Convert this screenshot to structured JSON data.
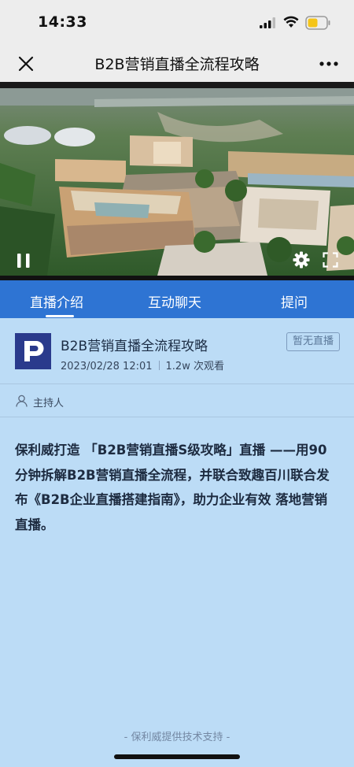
{
  "status_bar": {
    "time": "14:33",
    "icons": [
      "signal-icon",
      "wifi-icon",
      "battery-icon"
    ],
    "battery_color": "#f5c518"
  },
  "nav": {
    "title": "B2B营销直播全流程攻略",
    "icons": [
      "close-icon",
      "more-icon"
    ]
  },
  "video": {
    "controls": [
      "pause-icon",
      "gear-icon",
      "fullscreen-icon"
    ]
  },
  "tabs": {
    "items": [
      {
        "label": "直播介绍",
        "active": true
      },
      {
        "label": "互动聊天",
        "active": false
      },
      {
        "label": "提问",
        "active": false
      }
    ],
    "color": "#2e74d3"
  },
  "live": {
    "logo_icon": "channel-logo-icon",
    "title": "B2B营销直播全流程攻略",
    "datetime": "2023/02/28 12:01",
    "views": "1.2w 次观看",
    "status_badge": "暂无直播"
  },
  "host": {
    "icon": "user-icon",
    "label": "主持人"
  },
  "description": "保利威打造 「B2B营销直播S级攻略」直播 ——用90分钟拆解B2B营销直播全流程，并联合致趣百川联合发布《B2B企业直播搭建指南》，助力企业有效 落地营销直播。",
  "footer": "- 保利威提供技术支持 -",
  "colors": {
    "background": "#bcdcf6",
    "accent": "#2e74d3"
  }
}
